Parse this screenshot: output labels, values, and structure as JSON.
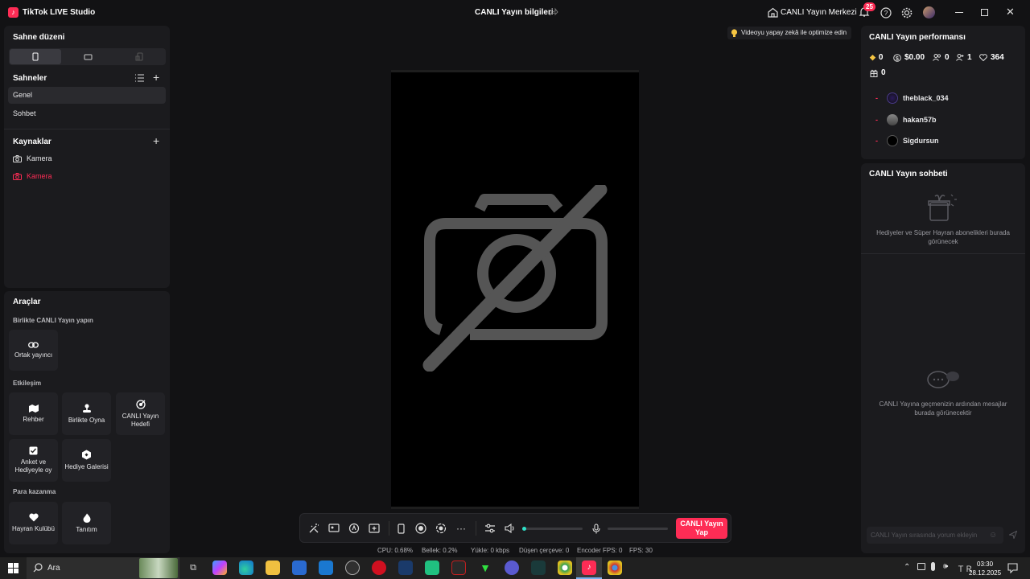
{
  "titlebar": {
    "app_title": "TikTok LIVE Studio",
    "center_title": "CANLI Yayın bilgileri",
    "live_center": "CANLI Yayın Merkezi",
    "notif_count": "25"
  },
  "left": {
    "scene_layout_title": "Sahne düzeni",
    "scenes_title": "Sahneler",
    "scenes": [
      "Genel",
      "Sohbet"
    ],
    "sources_title": "Kaynaklar",
    "sources": [
      "Kamera",
      "Kamera"
    ],
    "tools_title": "Araçlar",
    "together_header": "Birlikte CANLI Yayın yapın",
    "cohost": "Ortak yayıncı",
    "interaction_header": "Etkileşim",
    "guide": "Rehber",
    "play_together": "Birlikte Oyna",
    "live_goal": "CANLI Yayın Hedefi",
    "poll": "Anket ve Hediyeyle oy",
    "gift_gallery": "Hediye Galerisi",
    "earn_header": "Para kazanma",
    "fan_club": "Hayran Kulübü",
    "promote": "Tanıtım"
  },
  "center": {
    "tip": "Videoyu yapay zekâ ile optimize edin",
    "go_live": "CANLI Yayın Yap"
  },
  "stats": [
    {
      "label": "CPU:",
      "value": "0.68%"
    },
    {
      "label": "Bellek:",
      "value": "0.2%"
    },
    {
      "label": "Yükle:",
      "value": "0 kbps"
    },
    {
      "label": "Düşen çerçeve:",
      "value": "0"
    },
    {
      "label": "Encoder FPS:",
      "value": "0"
    },
    {
      "label": "FPS:",
      "value": "30"
    }
  ],
  "right": {
    "performance_title": "CANLI Yayın performansı",
    "diamonds": "0",
    "earnings": "$0.00",
    "viewers": "0",
    "new_followers": "1",
    "likes": "364",
    "gifts": "0",
    "top_viewers": [
      "theblack_034",
      "hakan57b",
      "Sigdursun"
    ],
    "chat_title": "CANLI Yayın sohbeti",
    "gifts_empty": "Hediyeler ve Süper Hayran abonelikleri burada görünecek",
    "chat_empty": "CANLI Yayına geçmenizin ardından mesajlar burada görünecektir",
    "chat_placeholder": "CANLI Yayın sırasında yorum ekleyin"
  },
  "taskbar": {
    "search": "Ara",
    "time": "03:30",
    "date": "28.12.2025"
  },
  "colors": {
    "accent": "#fe2c55",
    "bg": "#121214",
    "panel": "#1b1b1e"
  }
}
